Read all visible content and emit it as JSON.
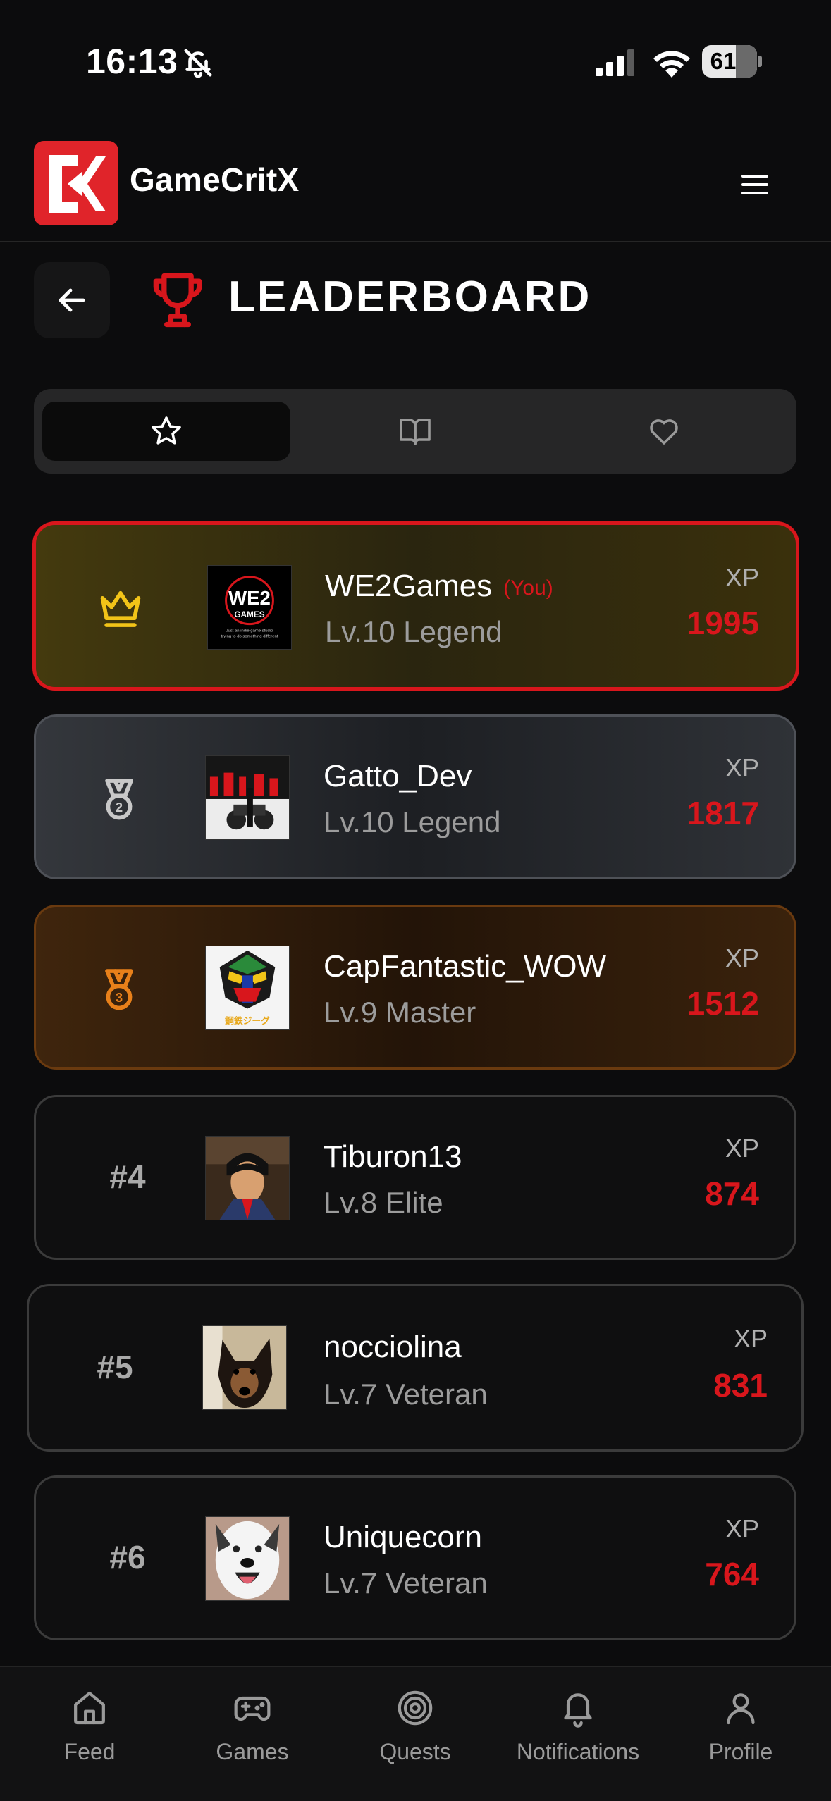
{
  "status_bar": {
    "time": "16:13",
    "battery": "61",
    "battery_level": 0.61
  },
  "header": {
    "brand": "GameCritX"
  },
  "page": {
    "title": "LEADERBOARD"
  },
  "tabs": [
    {
      "icon": "star-icon",
      "active": true
    },
    {
      "icon": "book-open-icon",
      "active": false
    },
    {
      "icon": "heart-icon",
      "active": false
    }
  ],
  "leaderboard": [
    {
      "rank": "1",
      "rank_icon": "crown-icon",
      "name": "WE2Games",
      "you_tag": "(You)",
      "level": "Lv.10 Legend",
      "xp_label": "XP",
      "xp": "1995",
      "avatar_text": "WE2",
      "avatar_sub": "GAMES",
      "avatar_caption_1": "Just an indie game studio",
      "avatar_caption_2": "trying to do something different"
    },
    {
      "rank": "2",
      "rank_icon": "silver-medal-icon",
      "name": "Gatto_Dev",
      "level": "Lv.10 Legend",
      "xp_label": "XP",
      "xp": "1817"
    },
    {
      "rank": "3",
      "rank_icon": "bronze-medal-icon",
      "name": "CapFantastic_WOW",
      "level": "Lv.9 Master",
      "xp_label": "XP",
      "xp": "1512",
      "avatar_caption": "鋼鉄ジーグ"
    },
    {
      "rank": "#4",
      "name": "Tiburon13",
      "level": "Lv.8 Elite",
      "xp_label": "XP",
      "xp": "874"
    },
    {
      "rank": "#5",
      "name": "nocciolina",
      "level": "Lv.7 Veteran",
      "xp_label": "XP",
      "xp": "831"
    },
    {
      "rank": "#6",
      "name": "Uniquecorn",
      "level": "Lv.7 Veteran",
      "xp_label": "XP",
      "xp": "764"
    }
  ],
  "bottom_nav": [
    {
      "label": "Feed",
      "icon": "home-icon"
    },
    {
      "label": "Games",
      "icon": "gamepad-icon"
    },
    {
      "label": "Quests",
      "icon": "target-icon"
    },
    {
      "label": "Notifications",
      "icon": "bell-icon"
    },
    {
      "label": "Profile",
      "icon": "user-icon"
    }
  ],
  "colors": {
    "accent": "#d8161c",
    "gold": "#f2c418",
    "silver": "#c8c8c8",
    "bronze": "#e8801a",
    "background": "#0c0c0d"
  }
}
